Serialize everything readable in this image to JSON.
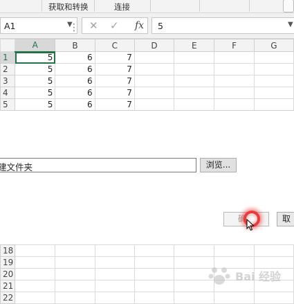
{
  "ribbon": {
    "groups": [
      "获取和转换",
      "连接"
    ]
  },
  "formula_bar": {
    "name_box": "A1",
    "fx_label": "fx",
    "formula_value": "5"
  },
  "sheet": {
    "columns": [
      "A",
      "B",
      "C",
      "D",
      "E",
      "F",
      "G"
    ],
    "rows_top": [
      {
        "num": "1",
        "cells": [
          "5",
          "6",
          "7",
          "",
          "",
          "",
          ""
        ]
      },
      {
        "num": "2",
        "cells": [
          "5",
          "6",
          "7",
          "",
          "",
          "",
          ""
        ]
      },
      {
        "num": "3",
        "cells": [
          "5",
          "6",
          "7",
          "",
          "",
          "",
          ""
        ]
      },
      {
        "num": "4",
        "cells": [
          "5",
          "6",
          "7",
          "",
          "",
          "",
          ""
        ]
      },
      {
        "num": "5",
        "cells": [
          "5",
          "6",
          "7",
          "",
          "",
          "",
          ""
        ]
      }
    ],
    "rows_bottom": [
      "18",
      "19",
      "20",
      "21",
      "22"
    ],
    "accent_color": "#217346"
  },
  "dialog": {
    "folder_path": "建文件夹",
    "browse_label": "浏览...",
    "ok_label": "确定",
    "cancel_label": "取"
  },
  "watermark": {
    "text": "Bai 经验"
  }
}
